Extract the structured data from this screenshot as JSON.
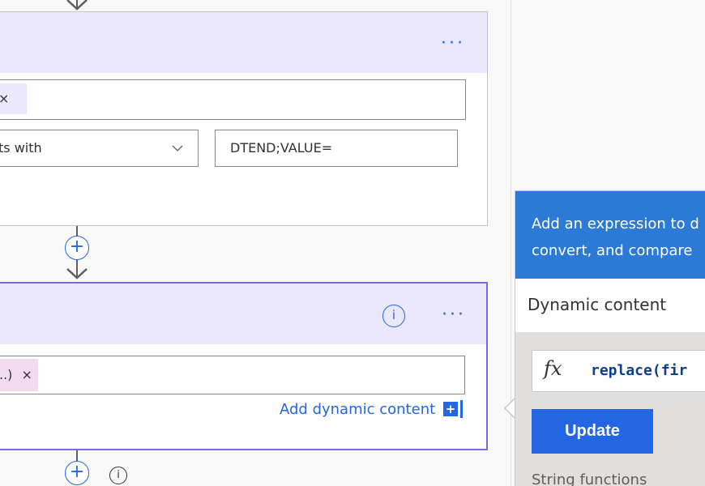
{
  "card1": {
    "token_remove": "×",
    "condition_operator": "ts with",
    "condition_value": "DTEND;VALUE="
  },
  "card2": {
    "token_text": "..)",
    "token_remove": "×",
    "add_dynamic_content": "Add dynamic content",
    "add_dynamic_plus": "+"
  },
  "expression_panel": {
    "header_line1": "Add an expression to d",
    "header_line2": "convert, and compare",
    "tab_dynamic": "Dynamic content",
    "fx_symbol": "fx",
    "expression": "replace(fir",
    "update_label": "Update",
    "section_label": "String functions"
  },
  "icons": {
    "more": "···",
    "add": "+",
    "info": "i"
  },
  "colors": {
    "accent": "#2266e3",
    "header_bg": "#ebe7fc",
    "selected_border": "#7b66e3",
    "panel_header": "#2b7ad6"
  }
}
